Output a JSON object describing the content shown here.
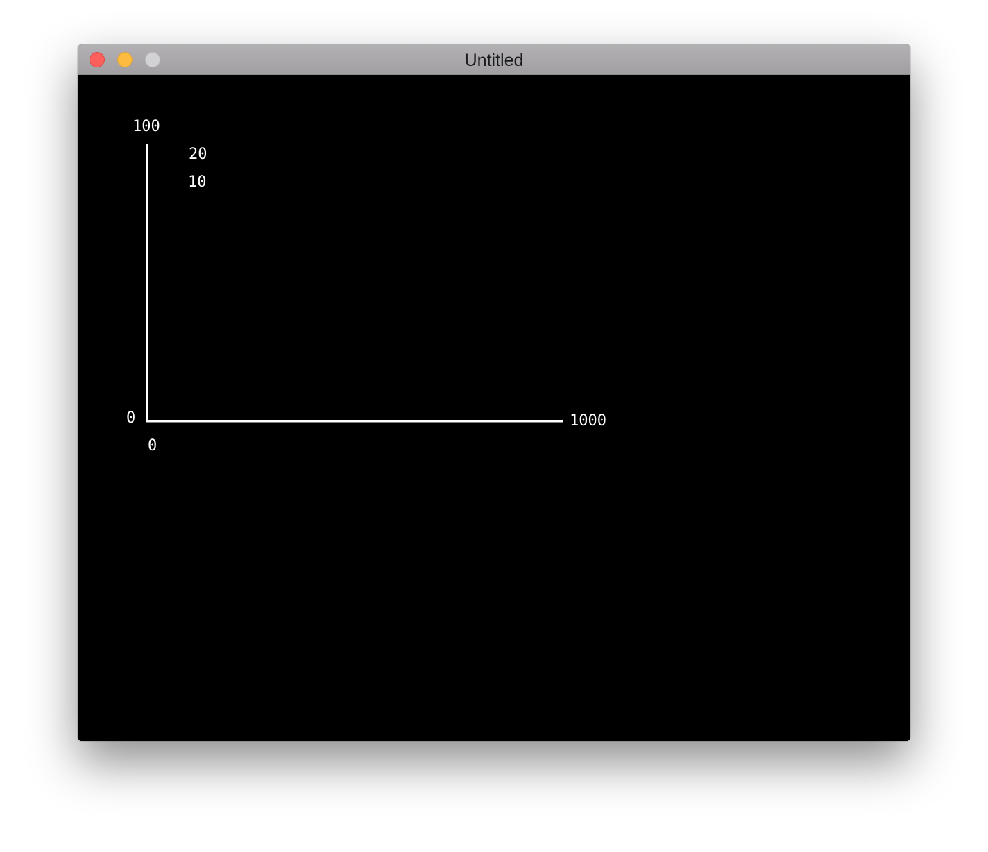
{
  "window": {
    "title": "Untitled"
  },
  "chart_data": {
    "type": "line",
    "title": "",
    "xlabel": "",
    "ylabel": "",
    "xlim": [
      0,
      1000
    ],
    "ylim": [
      0,
      100
    ],
    "x_tick_labels": {
      "min": "0",
      "max": "1000"
    },
    "y_tick_labels": {
      "min": "0",
      "max": "100"
    },
    "annotations": [
      "20",
      "10"
    ],
    "grid": false,
    "series": []
  }
}
